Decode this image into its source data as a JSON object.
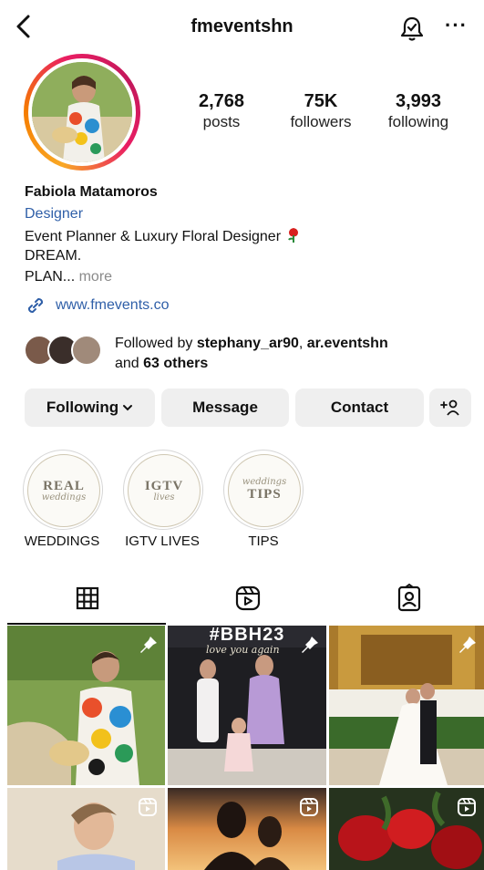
{
  "header": {
    "username": "fmeventshn",
    "back_icon": "chevron-left-icon",
    "notify_icon": "bell-icon",
    "more_label": "···"
  },
  "stats": {
    "posts_count": "2,768",
    "posts_label": "posts",
    "followers_count": "75K",
    "followers_label": "followers",
    "following_count": "3,993",
    "following_label": "following"
  },
  "bio": {
    "name": "Fabiola Matamoros",
    "category": "Designer",
    "line1": "Event Planner & Luxury Floral Designer",
    "line2": "DREAM.",
    "line3": "PLAN...",
    "more_label": " more",
    "link": "www.fmevents.co"
  },
  "followed_by": {
    "prefix": "Followed by ",
    "user1": "stephany_ar90",
    "sep": ", ",
    "user2": "ar.eventshn",
    "and": "and ",
    "others": "63 others"
  },
  "buttons": {
    "following": "Following",
    "message": "Message",
    "contact": "Contact"
  },
  "highlights": [
    {
      "label": "WEDDINGS",
      "cover_big": "REAL",
      "cover_script": "weddings"
    },
    {
      "label": "IGTV LIVES",
      "cover_big": "IGTV",
      "cover_script": "lives"
    },
    {
      "label": "TIPS",
      "cover_big": "TIPS",
      "cover_script": "weddings"
    }
  ],
  "tabs": [
    {
      "name": "grid-icon",
      "active": true
    },
    {
      "name": "reels-icon",
      "active": false
    },
    {
      "name": "tagged-icon",
      "active": false
    }
  ],
  "grid": {
    "post2_overlay": "#BBH23",
    "post2_script": "love you again"
  },
  "colors": {
    "link_blue": "#2f5fa8",
    "button_gray": "#efefef",
    "muted_gray": "#8a8a8a"
  }
}
